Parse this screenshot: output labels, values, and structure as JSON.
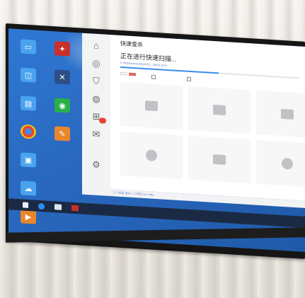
{
  "scan": {
    "title": "快速查杀",
    "status": "正在进行快速扫描...",
    "path": "C:\\Windows\\system32\\C_20001.NLS",
    "progress": 0.55
  },
  "status_bar": {
    "text": "3 个项目    选中 1 个项目 44.4 MB"
  },
  "colors": {
    "desktop_blue": "#2a69c0",
    "panel_bg": "#ffffff",
    "accent": "#d96a5d",
    "taskbar": "#1b2a44"
  }
}
